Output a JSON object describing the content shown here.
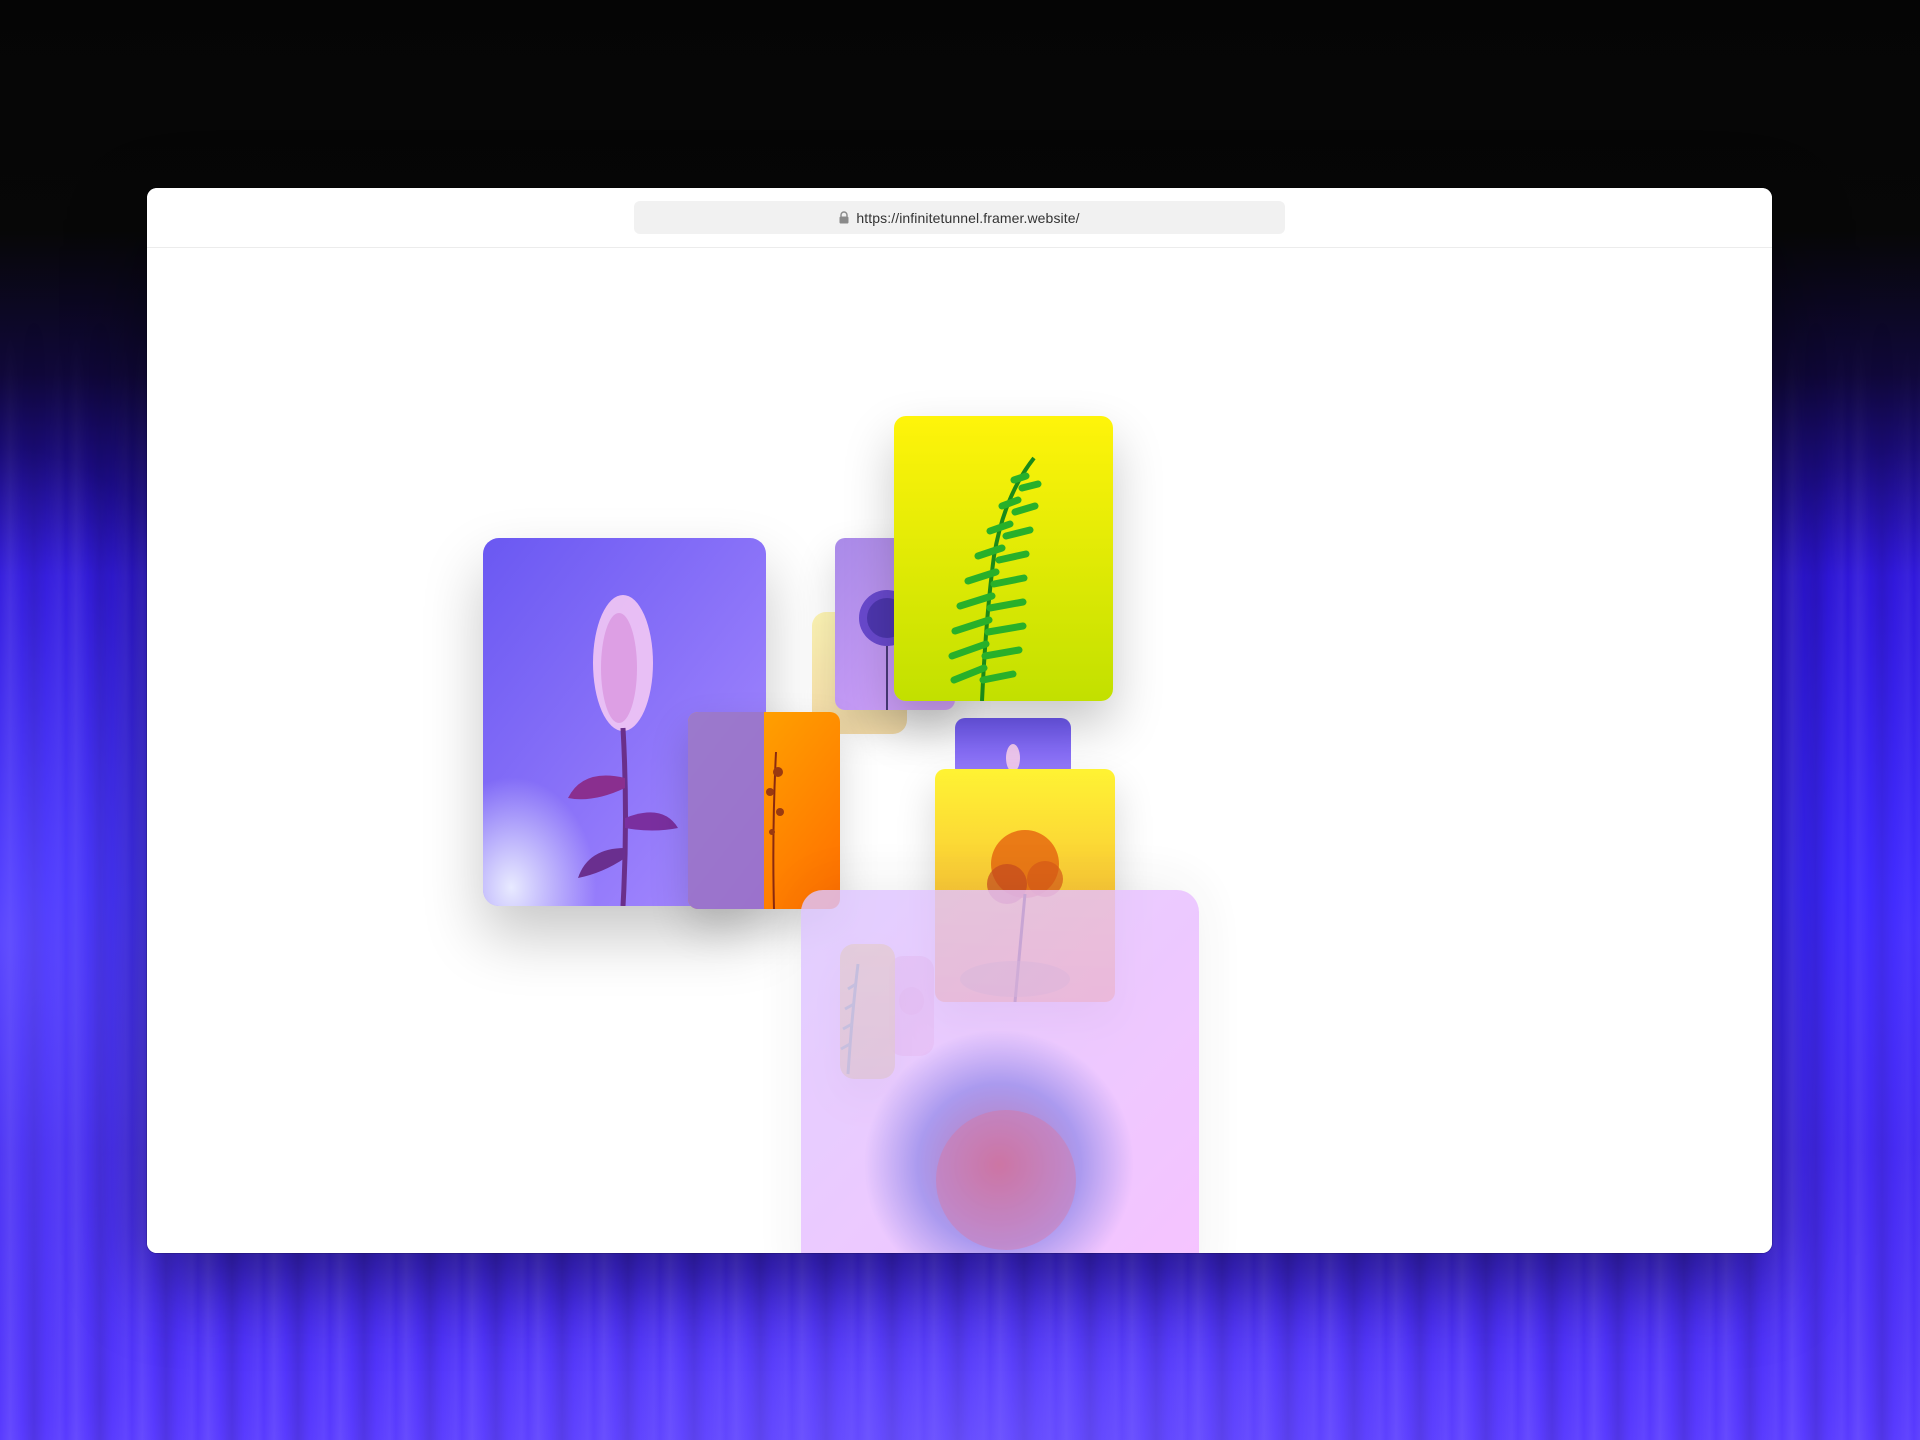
{
  "browser": {
    "url": "https://infinitetunnel.framer.website/",
    "lock_icon": "lock-icon"
  },
  "page": {
    "cards": [
      {
        "name": "card-purple-spirea",
        "subject": "pink-flower-spike",
        "colors": [
          "#7a6cff",
          "#a784ff"
        ]
      },
      {
        "name": "card-yellow-fern",
        "subject": "green-fern-leaf",
        "colors": [
          "#fff200",
          "#c4e300"
        ]
      },
      {
        "name": "card-purple-allium-small",
        "subject": "purple-allium",
        "colors": [
          "#9a7ce8",
          "#d1a0ff"
        ]
      },
      {
        "name": "card-orange-dried-flower",
        "subject": "dried-flower",
        "colors": [
          "#ffb000",
          "#ff7a00"
        ]
      },
      {
        "name": "card-yellow-orange-tree",
        "subject": "orange-flower-tree",
        "colors": [
          "#fff333",
          "#f59a2a"
        ]
      },
      {
        "name": "card-pink-allium-large",
        "subject": "allium-sphere",
        "colors": [
          "#dcc8ff",
          "#f0b8ff"
        ]
      }
    ]
  }
}
